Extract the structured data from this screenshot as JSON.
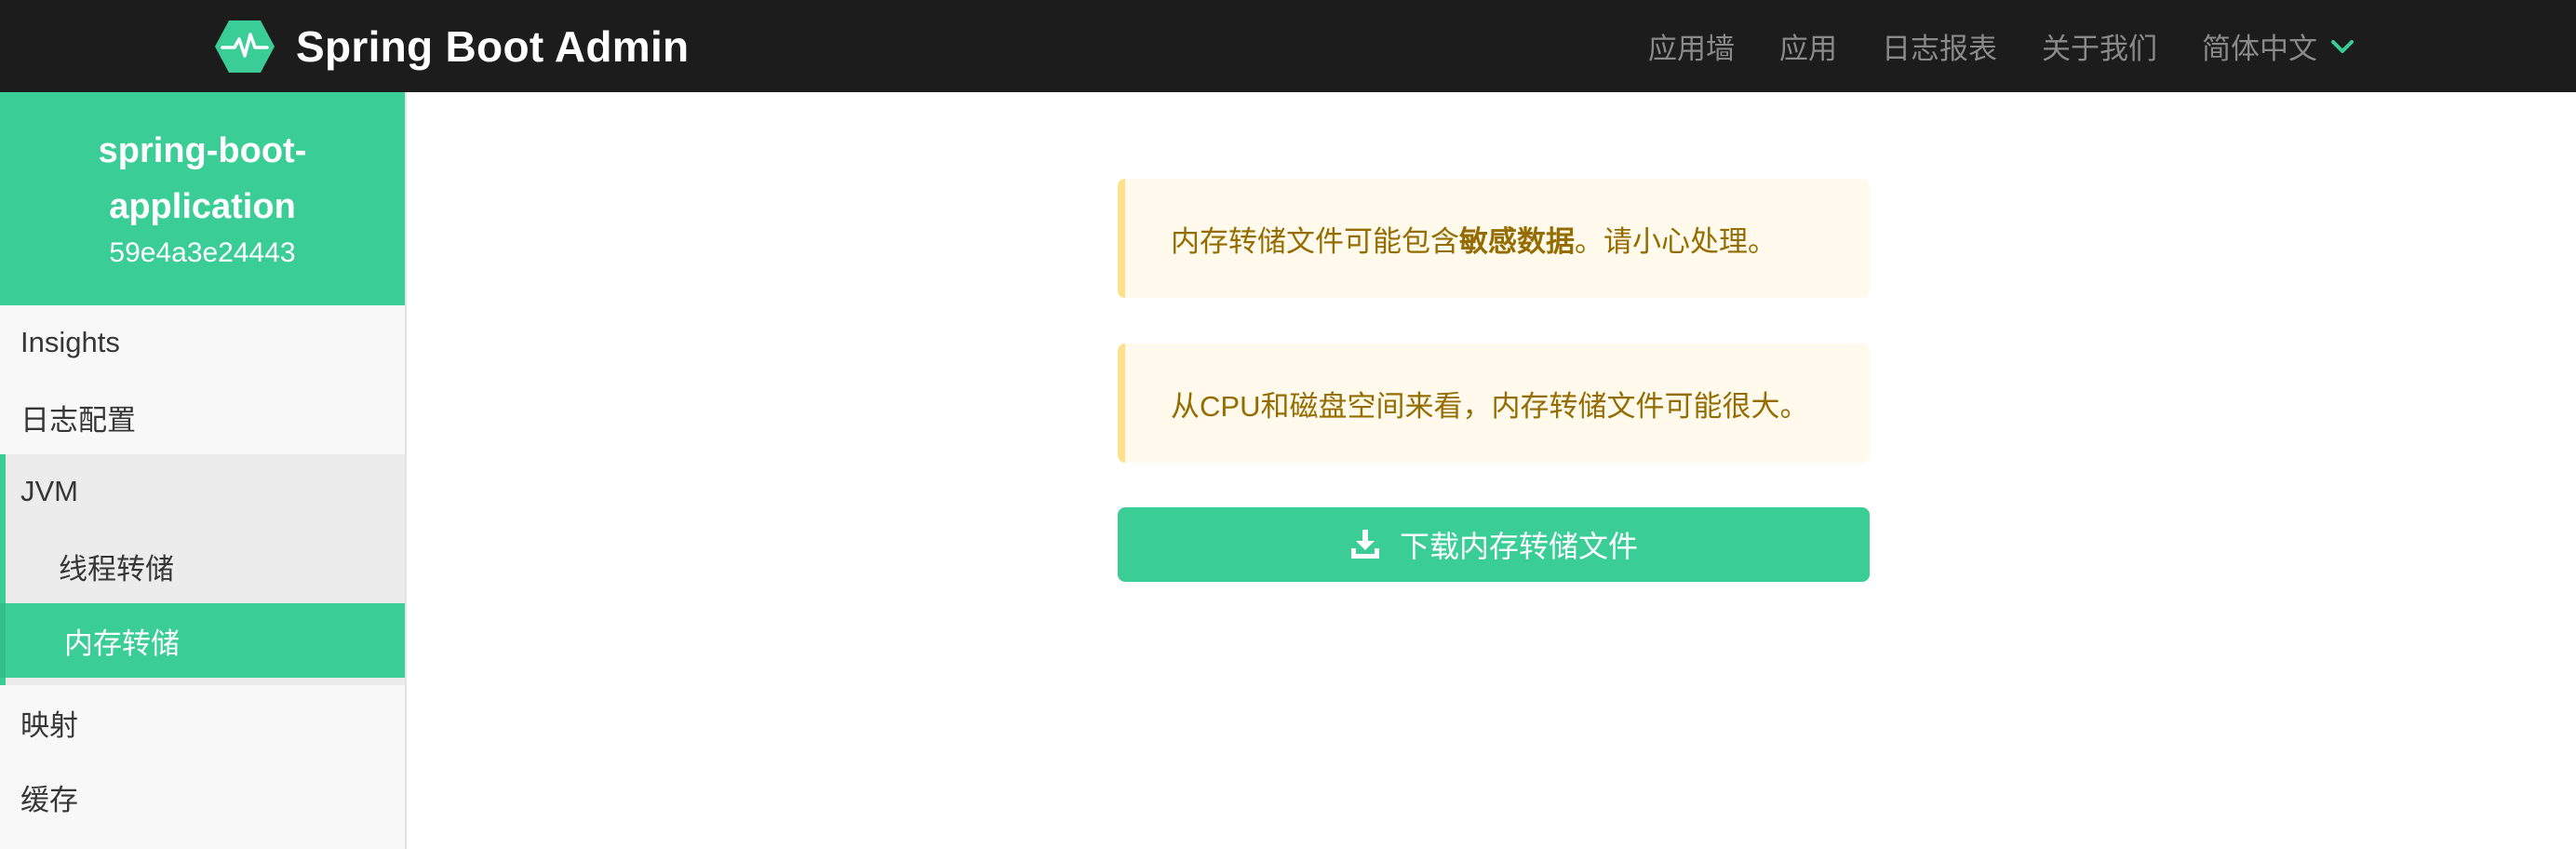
{
  "navbar": {
    "brand": "Spring Boot Admin",
    "items": [
      "应用墙",
      "应用",
      "日志报表",
      "关于我们"
    ],
    "language": "简体中文"
  },
  "sidebar": {
    "app_name_line1": "spring-boot-",
    "app_name_line2": "application",
    "app_id": "59e4a3e24443",
    "items": {
      "insights": "Insights",
      "logging": "日志配置",
      "jvm": "JVM",
      "threaddump": "线程转储",
      "heapdump": "内存转储",
      "mappings": "映射",
      "caches": "缓存"
    }
  },
  "main": {
    "notice1_prefix": "内存转储文件可能包含",
    "notice1_bold": "敏感数据",
    "notice1_suffix": "。请小心处理。",
    "notice2": "从CPU和磁盘空间来看，内存转储文件可能很大。",
    "download_label": "下载内存转储文件"
  },
  "colors": {
    "brand_green": "#3acd96",
    "navbar_bg": "#1c1c1c",
    "warning_bg": "#fffaeb",
    "warning_text": "#946c00",
    "warning_border": "#ffe08a"
  },
  "icons": {
    "brand": "heartbeat-hexagon-icon",
    "language_dropdown": "chevron-down-icon",
    "download": "download-icon"
  }
}
